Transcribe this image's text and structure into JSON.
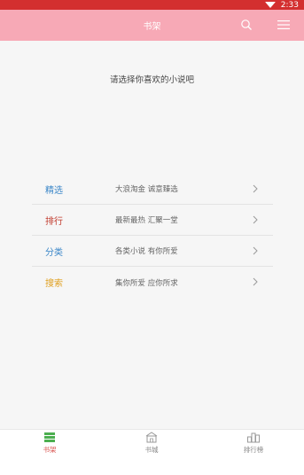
{
  "status": {
    "time": "2:33"
  },
  "appbar": {
    "title": "书架",
    "search_icon": "search-icon",
    "menu_icon": "menu-icon"
  },
  "prompt": "请选择你喜欢的小说吧",
  "list": [
    {
      "name": "精选",
      "desc": "大浪淘金 诚意臻选",
      "color": "#3a86c8"
    },
    {
      "name": "排行",
      "desc": "最新最热 汇聚一堂",
      "color": "#c0392b"
    },
    {
      "name": "分类",
      "desc": "各类小说 有你所爱",
      "color": "#3a86c8"
    },
    {
      "name": "搜索",
      "desc": "集你所爱 应你所求",
      "color": "#e0a020"
    }
  ],
  "tabs": [
    {
      "label": "书架",
      "icon": "bookshelf-icon",
      "active": true
    },
    {
      "label": "书城",
      "icon": "bookstore-icon",
      "active": false
    },
    {
      "label": "排行榜",
      "icon": "ranking-icon",
      "active": false
    }
  ],
  "colors": {
    "status_bar": "#d32f2f",
    "app_bar": "#f7a9b6",
    "active_tab": "#4caf50"
  }
}
